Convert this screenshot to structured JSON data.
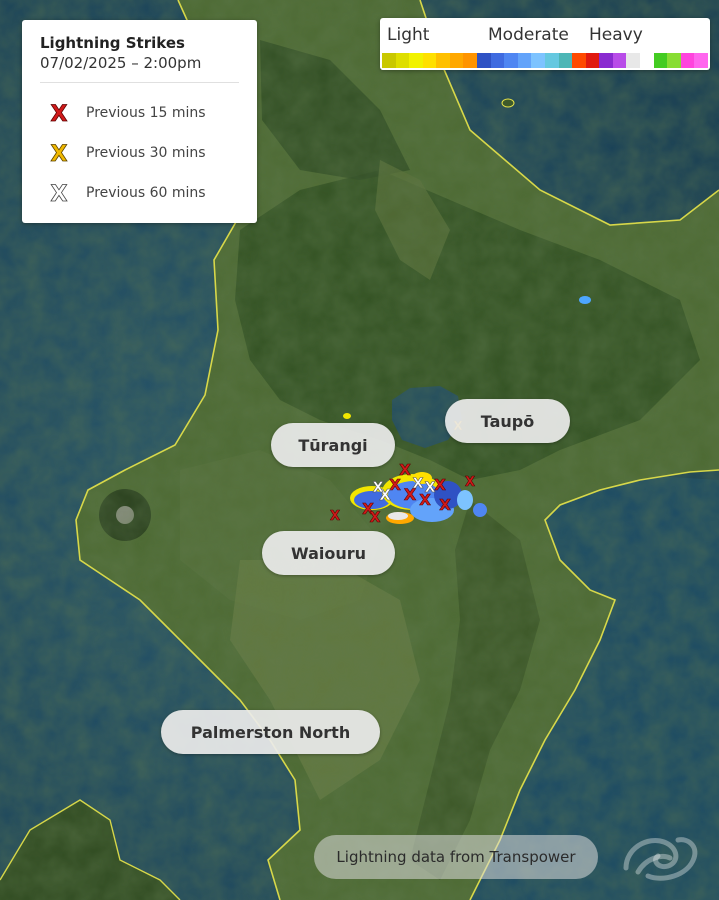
{
  "legend": {
    "title": "Lightning Strikes",
    "timestamp": "07/02/2025 – 2:00pm",
    "items": [
      {
        "label": "Previous 15 mins",
        "color": "#d11a1a"
      },
      {
        "label": "Previous 30 mins",
        "color": "#f0b800"
      },
      {
        "label": "Previous 60 mins",
        "color": "#ffffff"
      }
    ]
  },
  "intensity_scale": {
    "labels": [
      "Light",
      "Moderate",
      "Heavy"
    ],
    "colors": [
      "#c9c800",
      "#dede00",
      "#f2f200",
      "#ffe000",
      "#ffc000",
      "#ffa800",
      "#ff9400",
      "#2f52c4",
      "#3f6be0",
      "#4f86f2",
      "#63a3fa",
      "#7dc3ff",
      "#65c8e0",
      "#4db6b6",
      "#ff4a00",
      "#e01a10",
      "#8a2ad0",
      "#b84ce8",
      "#e8e8e8",
      "#ffffff",
      "#44cc22",
      "#88dd33",
      "#ff44dd",
      "#ff66ee"
    ]
  },
  "places": [
    "Tūrangi",
    "Taupō",
    "Waiouru",
    "Palmerston North"
  ],
  "credit": "Lightning data from Transpower",
  "colors": {
    "sea": "#1d4a63",
    "land": "#4f6a35",
    "forest": "#2f4d22",
    "coast": "#e8e44a"
  }
}
